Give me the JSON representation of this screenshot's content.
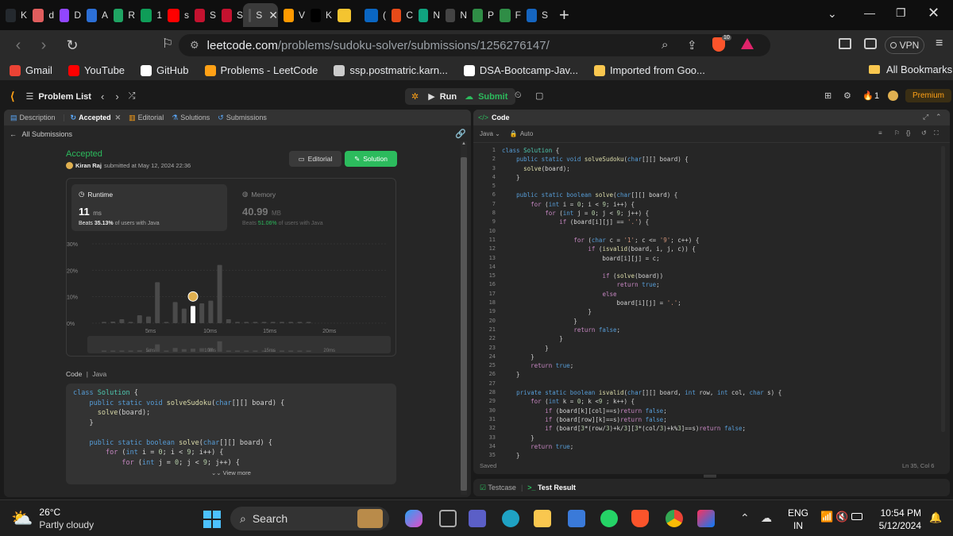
{
  "browser": {
    "tabs": [
      {
        "label": "K",
        "icon": "github-icon",
        "color": "#24292e"
      },
      {
        "label": "d",
        "icon": "s-icon",
        "color": "#e05d5d"
      },
      {
        "label": "D",
        "icon": "twitch-icon",
        "color": "#9146ff"
      },
      {
        "label": "A",
        "icon": "c-icon",
        "color": "#2c6fd6"
      },
      {
        "label": "R",
        "icon": "drive-icon",
        "color": "#1fa463"
      },
      {
        "label": "1",
        "icon": "sheets-icon",
        "color": "#0f9d58"
      },
      {
        "label": "s",
        "icon": "youtube-icon",
        "color": "#ff0000"
      },
      {
        "label": "S",
        "icon": "tuf-icon",
        "color": "#c4122f"
      },
      {
        "label": "S",
        "icon": "tuf-icon",
        "color": "#c4122f"
      },
      {
        "label": "S",
        "icon": "s-icon",
        "color": "#555555",
        "active": true
      },
      {
        "label": "V",
        "icon": "amazon-icon",
        "color": "#ff9900"
      },
      {
        "label": "K",
        "icon": "x-icon",
        "color": "#000000"
      },
      {
        "label": "",
        "icon": "circle-icon",
        "color": "#f4c430"
      },
      {
        "label": "(",
        "icon": "linkedin-icon",
        "color": "#0a66c2"
      },
      {
        "label": "C",
        "icon": "x-icon",
        "color": "#e64a19"
      },
      {
        "label": "N",
        "icon": "chatgpt-icon",
        "color": "#10a37f"
      },
      {
        "label": "N",
        "icon": "mt-icon",
        "color": "#444444"
      },
      {
        "label": "P",
        "icon": "gfg-icon",
        "color": "#2f8d46"
      },
      {
        "label": "F",
        "icon": "gfg-icon",
        "color": "#2f8d46"
      },
      {
        "label": "S",
        "icon": "bar-chart-icon",
        "color": "#1565c0"
      }
    ],
    "url_host": "leetcode.com",
    "url_path": "/problems/sudoku-solver/submissions/1256276147/",
    "brave_badge": "10",
    "vpn_label": "VPN",
    "bookmarks": [
      {
        "label": "Gmail",
        "icon": "gmail-icon",
        "color": "#ea4335"
      },
      {
        "label": "YouTube",
        "icon": "youtube-icon",
        "color": "#ff0000"
      },
      {
        "label": "GitHub",
        "icon": "github-icon",
        "color": "#ffffff"
      },
      {
        "label": "Problems - LeetCode",
        "icon": "leetcode-icon",
        "color": "#ffa116"
      },
      {
        "label": "ssp.postmatric.karn...",
        "icon": "globe-icon",
        "color": "#cccccc"
      },
      {
        "label": "DSA-Bootcamp-Jav...",
        "icon": "github-icon",
        "color": "#ffffff"
      },
      {
        "label": "Imported from Goo...",
        "icon": "folder-icon",
        "color": "#f9c74f"
      }
    ],
    "all_bookmarks": "All Bookmarks"
  },
  "lc": {
    "problem_list": "Problem List",
    "run": "Run",
    "submit": "Submit",
    "streak": "1",
    "premium": "Premium",
    "left_tabs": {
      "description": "Description",
      "accepted": "Accepted",
      "editorial": "Editorial",
      "solutions": "Solutions",
      "submissions": "Submissions"
    },
    "all_submissions": "All Submissions",
    "status": "Accepted",
    "user": "Kiran Raj",
    "submitted_text": "submitted at May 12, 2024 22:36",
    "editorial_btn": "Editorial",
    "solution_btn": "Solution",
    "runtime": {
      "label": "Runtime",
      "value": "11",
      "unit": "ms",
      "beats_prefix": "Beats",
      "beats": "35.13%",
      "beats_suffix": "of users with Java"
    },
    "memory": {
      "label": "Memory",
      "value": "40.99",
      "unit": "MB",
      "beats_prefix": "Beats",
      "beats": "51.06%",
      "beats_suffix": "of users with Java"
    },
    "code_lang": {
      "code": "Code",
      "lang": "Java"
    },
    "view_more": "View more",
    "left_code": [
      "class Solution {",
      "    public static void solveSudoku(char[][] board) {",
      "      solve(board);",
      "    }",
      "",
      "    public static boolean solve(char[][] board) {",
      "        for (int i = 0; i < 9; i++) {",
      "            for (int j = 0; j < 9; j++) {"
    ],
    "editor": {
      "title": "Code",
      "lang": "Java",
      "auto": "Auto",
      "saved": "Saved",
      "cursor": "Ln 35, Col 6",
      "testcase": "Testcase",
      "test_result": "Test Result",
      "lines": [
        "class Solution {",
        "    public static void solveSudoku(char[][] board) {",
        "      solve(board);",
        "    }",
        "",
        "    public static boolean solve(char[][] board) {",
        "        for (int i = 0; i < 9; i++) {",
        "            for (int j = 0; j < 9; j++) {",
        "                if (board[i][j] == '.') {",
        "",
        "                    for (char c = '1'; c <= '9'; c++) {",
        "                        if (isvalid(board, i, j, c)) {",
        "                            board[i][j] = c;",
        "",
        "                            if (solve(board))",
        "                                return true;",
        "                            else",
        "                                board[i][j] = '.';",
        "                        }",
        "                    }",
        "                    return false;",
        "                }",
        "            }",
        "        }",
        "        return true;",
        "    }",
        "",
        "    private static boolean isvalid(char[][] board, int row, int col, char s) {",
        "        for (int k = 0; k <9 ; k++) {",
        "            if (board[k][col]==s)return false;",
        "            if (board[row][k]==s)return false;",
        "            if (board[3*(row/3)+k/3][3*(col/3)+k%3]==s)return false;",
        "        }",
        "        return true;",
        "    }"
      ],
      "line_numbers": [
        "1",
        "2",
        "3",
        "4",
        "5",
        "6",
        "7",
        "8",
        "9",
        "10",
        "11",
        "12",
        "13",
        "14",
        "15",
        "16",
        "17",
        "18",
        "19",
        "20",
        "21",
        "22",
        "23",
        "24",
        "25",
        "26",
        "27",
        "28",
        "29",
        "30",
        "31",
        "32",
        "33",
        "34",
        "35"
      ]
    }
  },
  "chart_data": {
    "type": "bar",
    "yticks": [
      "30%",
      "20%",
      "10%",
      "0%"
    ],
    "ylim": [
      0,
      30
    ],
    "xticks": [
      "5ms",
      "10ms",
      "15ms",
      "20ms"
    ],
    "x": [
      1,
      2,
      3,
      4,
      5,
      6,
      7,
      8,
      9,
      10,
      11,
      12,
      13,
      14,
      15,
      16,
      17,
      18,
      19,
      20,
      21,
      22,
      23,
      24
    ],
    "values": [
      0.5,
      0.6,
      1.5,
      0.5,
      3,
      2.5,
      15.5,
      0.5,
      8,
      5.5,
      6.5,
      7.5,
      8.5,
      22,
      1.5,
      0.5,
      0.5,
      0.5,
      0.5,
      0.5,
      0.5,
      0.5,
      0.5,
      0.5
    ],
    "highlight_x": 11,
    "highlight_color": "#ffffff",
    "bar_color": "#4a4a4a"
  },
  "taskbar": {
    "temp": "26°C",
    "weather": "Partly cloudy",
    "search": "Search",
    "lang1": "ENG",
    "lang2": "IN",
    "time": "10:54 PM",
    "date": "5/12/2024"
  }
}
